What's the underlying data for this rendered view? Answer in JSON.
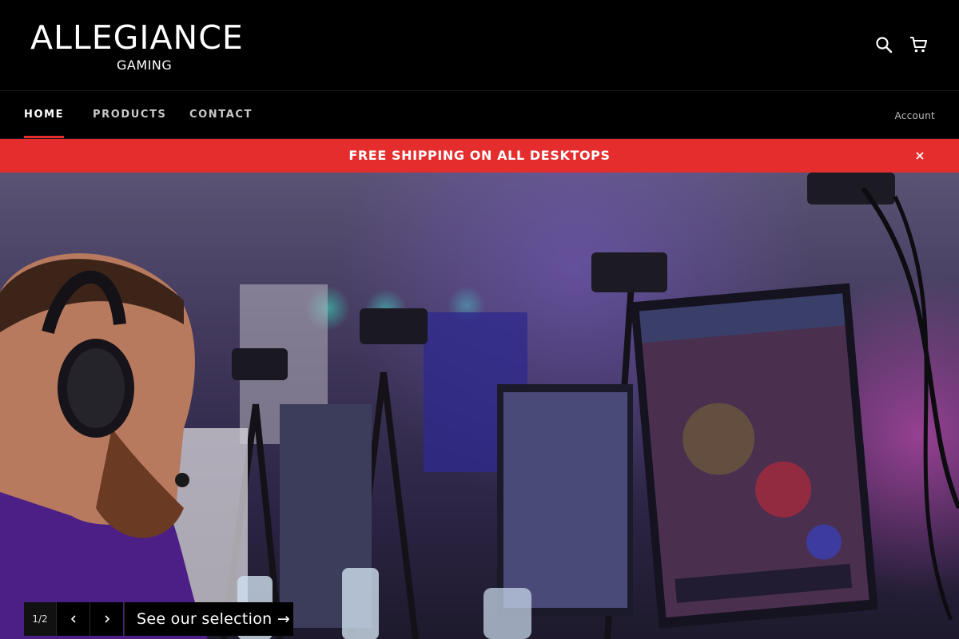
{
  "brand": {
    "logo_main": "ALLEGIANCE",
    "logo_sub": "GAMING"
  },
  "header": {
    "icons": [
      "search-icon",
      "cart-icon"
    ]
  },
  "nav": {
    "items": [
      {
        "label": "HOME",
        "active": true
      },
      {
        "label": "PRODUCTS",
        "active": false
      },
      {
        "label": "CONTACT",
        "active": false
      }
    ],
    "account_label": "Account"
  },
  "announcement": {
    "text": "FREE SHIPPING ON ALL DESKTOPS",
    "close_icon": "close-icon",
    "color": "#e52d2d"
  },
  "slideshow": {
    "counter": "1/2",
    "prev_icon": "chevron-left-icon",
    "next_icon": "chevron-right-icon",
    "cta_label": "See our selection →"
  },
  "colors": {
    "accent": "#e52d2d",
    "background": "#000000"
  }
}
